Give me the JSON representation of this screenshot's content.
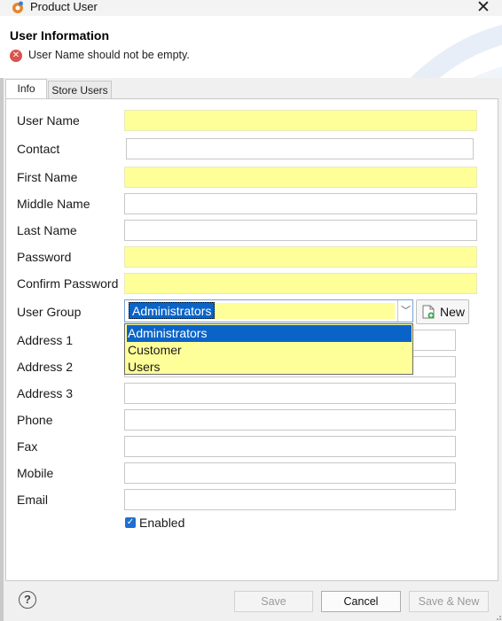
{
  "window": {
    "title": "Product User"
  },
  "banner": {
    "title": "User Information",
    "error": "User Name should not be empty."
  },
  "tabs": [
    {
      "label": "Info"
    },
    {
      "label": "Store Users"
    }
  ],
  "form": {
    "user_name": {
      "label": "User Name",
      "value": ""
    },
    "contact": {
      "label": "Contact",
      "value": ""
    },
    "first_name": {
      "label": "First Name",
      "value": ""
    },
    "middle_name": {
      "label": "Middle Name",
      "value": ""
    },
    "last_name": {
      "label": "Last Name",
      "value": ""
    },
    "password": {
      "label": "Password",
      "value": ""
    },
    "confirm_password": {
      "label": "Confirm Password",
      "value": ""
    },
    "user_group": {
      "label": "User Group",
      "value": "Administrators",
      "new_label": "New",
      "options": [
        "Administrators",
        "Customer",
        "Users"
      ]
    },
    "address1": {
      "label": "Address 1",
      "value": ""
    },
    "address2": {
      "label": "Address 2",
      "value": ""
    },
    "address3": {
      "label": "Address 3",
      "value": ""
    },
    "phone": {
      "label": "Phone",
      "value": ""
    },
    "fax": {
      "label": "Fax",
      "value": ""
    },
    "mobile": {
      "label": "Mobile",
      "value": ""
    },
    "email": {
      "label": "Email",
      "value": ""
    },
    "enabled": {
      "label": "Enabled",
      "checked": true
    }
  },
  "footer": {
    "help": "?",
    "save": "Save",
    "cancel": "Cancel",
    "save_new": "Save & New"
  },
  "colors": {
    "required": "#ffff99",
    "selection": "#0a64c8",
    "error": "#d9534f"
  },
  "icons": {
    "app": "gear-person-icon",
    "error": "error-circle-icon",
    "new": "new-document-icon",
    "help": "help-circle-icon"
  }
}
